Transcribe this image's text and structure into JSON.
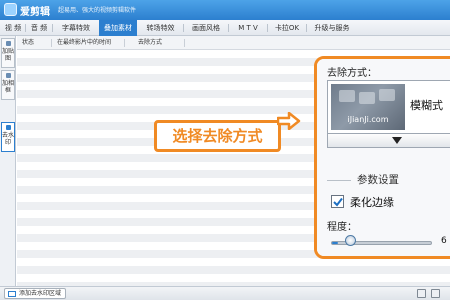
{
  "app": {
    "title": "爱剪辑",
    "tagline": "超易用、强大的视频剪辑软件"
  },
  "tabs": [
    {
      "label": "视  频",
      "active": false
    },
    {
      "label": "音  频",
      "active": false
    },
    {
      "label": "字幕特效",
      "active": false
    },
    {
      "label": "叠加素材",
      "active": true
    },
    {
      "label": "转场特效",
      "active": false
    },
    {
      "label": "画面风格",
      "active": false
    },
    {
      "label": "M T V",
      "active": false
    },
    {
      "label": "卡拉OK",
      "active": false
    },
    {
      "label": "升级与服务",
      "active": false
    }
  ],
  "sidebar": {
    "items": [
      {
        "label": "加贴图",
        "active": false
      },
      {
        "label": "加相框",
        "active": false
      },
      {
        "label": "去水印",
        "active": true
      }
    ]
  },
  "list": {
    "columns": [
      "状态",
      "在最终影片中的时间",
      "去除方式"
    ]
  },
  "callout": {
    "text": "选择去除方式"
  },
  "panel": {
    "removal_label": "去除方式：",
    "preview_watermark": "iJianJi.com",
    "method_name": "模糊式",
    "param_title": "参数设置",
    "soften_edges_label": "柔化边缘",
    "soften_edges_checked": true,
    "degree_label": "程度：",
    "degree_value": "6",
    "degree_fraction": 0.06
  },
  "statusbar": {
    "add_area_label": "添加去水印区域"
  },
  "colors": {
    "accent": "#2c7fcf",
    "highlight": "#f08a24"
  }
}
